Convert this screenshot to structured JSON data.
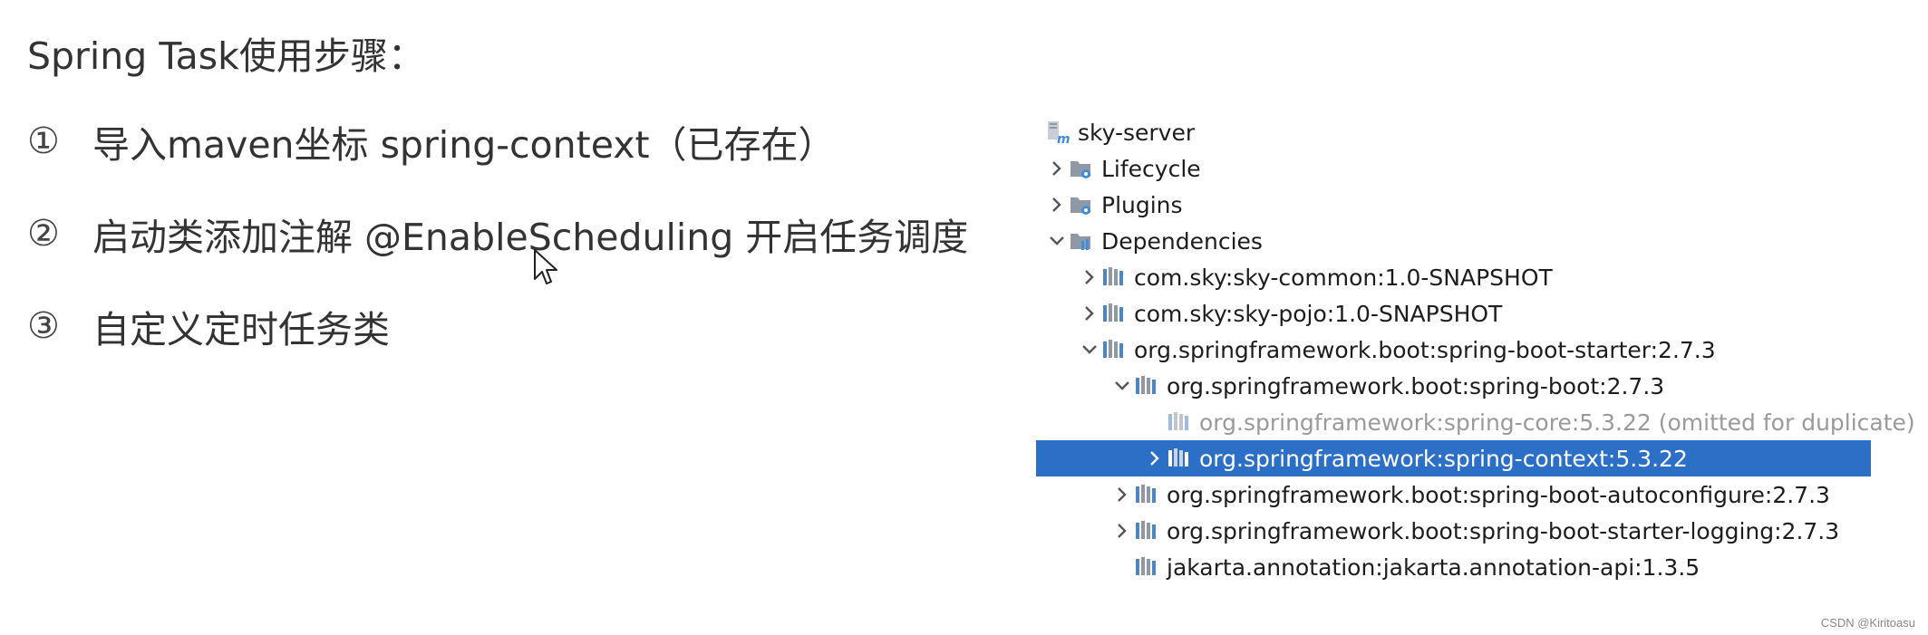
{
  "slide": {
    "title": "Spring Task使用步骤：",
    "steps": [
      {
        "num": "①",
        "text": "导入maven坐标 spring-context（已存在）"
      },
      {
        "num": "②",
        "text": "启动类添加注解 @EnableScheduling 开启任务调度"
      },
      {
        "num": "③",
        "text": "自定义定时任务类"
      }
    ]
  },
  "tree": {
    "root": "sky-server",
    "lifecycle": "Lifecycle",
    "plugins": "Plugins",
    "dependencies": "Dependencies",
    "items": [
      {
        "label": "com.sky:sky-common:1.0-SNAPSHOT"
      },
      {
        "label": "com.sky:sky-pojo:1.0-SNAPSHOT"
      },
      {
        "label": "org.springframework.boot:spring-boot-starter:2.7.3"
      },
      {
        "label": "org.springframework.boot:spring-boot:2.7.3"
      },
      {
        "label": "org.springframework:spring-core:5.3.22 (omitted for duplicate)"
      },
      {
        "label": "org.springframework:spring-context:5.3.22"
      },
      {
        "label": "org.springframework.boot:spring-boot-autoconfigure:2.7.3"
      },
      {
        "label": "org.springframework.boot:spring-boot-starter-logging:2.7.3"
      },
      {
        "label": "jakarta.annotation:jakarta.annotation-api:1.3.5"
      }
    ]
  },
  "colors": {
    "selection": "#2c6fc6",
    "text": "#1d1d1d",
    "muted": "#9a9a9a",
    "maven_icon": "#3f8fd8",
    "library_icon": "#4a86c8"
  },
  "watermark": "CSDN @Kiritoasu"
}
